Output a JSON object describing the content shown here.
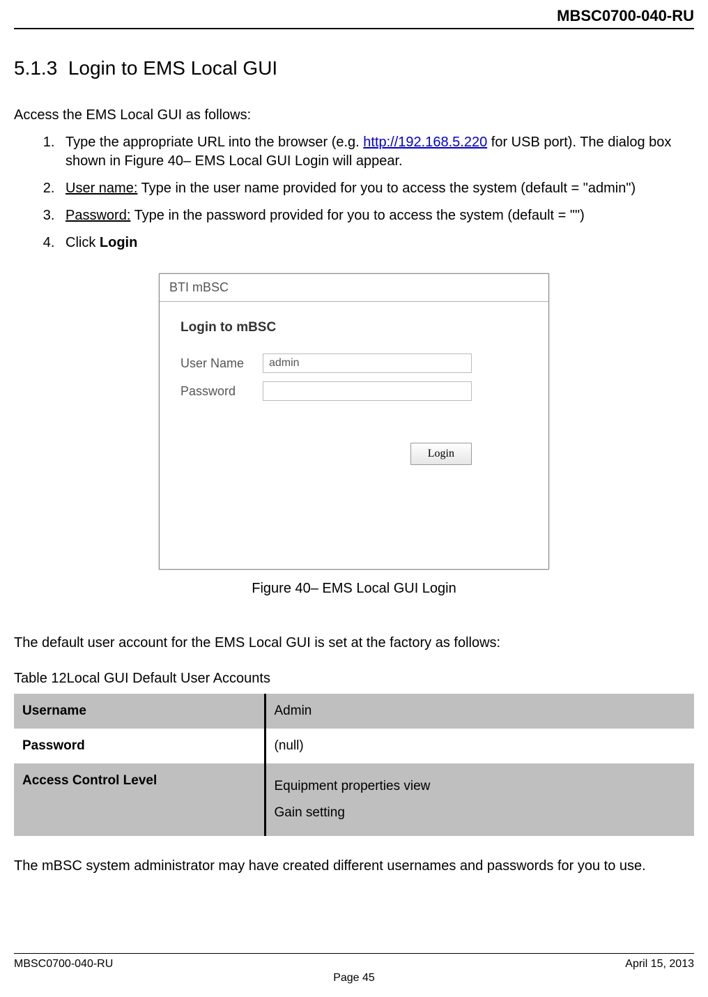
{
  "header": {
    "doc_code": "MBSC0700-040-RU"
  },
  "section": {
    "number": "5.1.3",
    "title": "Login to EMS Local GUI"
  },
  "intro": "Access the EMS Local GUI as follows:",
  "steps": {
    "s1_a": "Type the appropriate URL into the browser (e.g. ",
    "s1_link": "http://192.168.5.220",
    "s1_b": " for USB port). The dialog box shown in Figure 40– EMS Local GUI Login will appear.",
    "s2_label": "User name:",
    "s2_rest": " Type in the user name provided for you to access the system (default = \"admin\")",
    "s3_label": "Password:",
    "s3_rest": " Type in the password provided for you to access the system (default = \"\")",
    "s4_a": "Click ",
    "s4_b": "Login"
  },
  "figure": {
    "titlebar": "BTI mBSC",
    "heading": "Login to mBSC",
    "user_label": "User Name",
    "user_value": "admin",
    "pwd_label": "Password",
    "btn": "Login",
    "caption": "Figure 40– EMS Local GUI Login"
  },
  "para_default": "The default user account for the EMS Local GUI is set at the factory as follows:",
  "table": {
    "caption": "Table 12Local GUI Default User Accounts",
    "r1_k": "Username",
    "r1_v": "Admin",
    "r2_k": "Password",
    "r2_v": "(null)",
    "r3_k": "Access Control Level",
    "r3_v1": "Equipment properties view",
    "r3_v2": "Gain setting"
  },
  "para_admin": "The mBSC system administrator may have created different usernames and passwords for you to use.",
  "footer": {
    "left": "MBSC0700-040-RU",
    "right": "April 15, 2013",
    "page": "Page 45"
  },
  "chart_data": {
    "type": "table",
    "title": "Local GUI Default User Accounts",
    "rows": [
      {
        "Username": "Admin"
      },
      {
        "Password": "(null)"
      },
      {
        "Access Control Level": [
          "Equipment properties view",
          "Gain setting"
        ]
      }
    ]
  }
}
